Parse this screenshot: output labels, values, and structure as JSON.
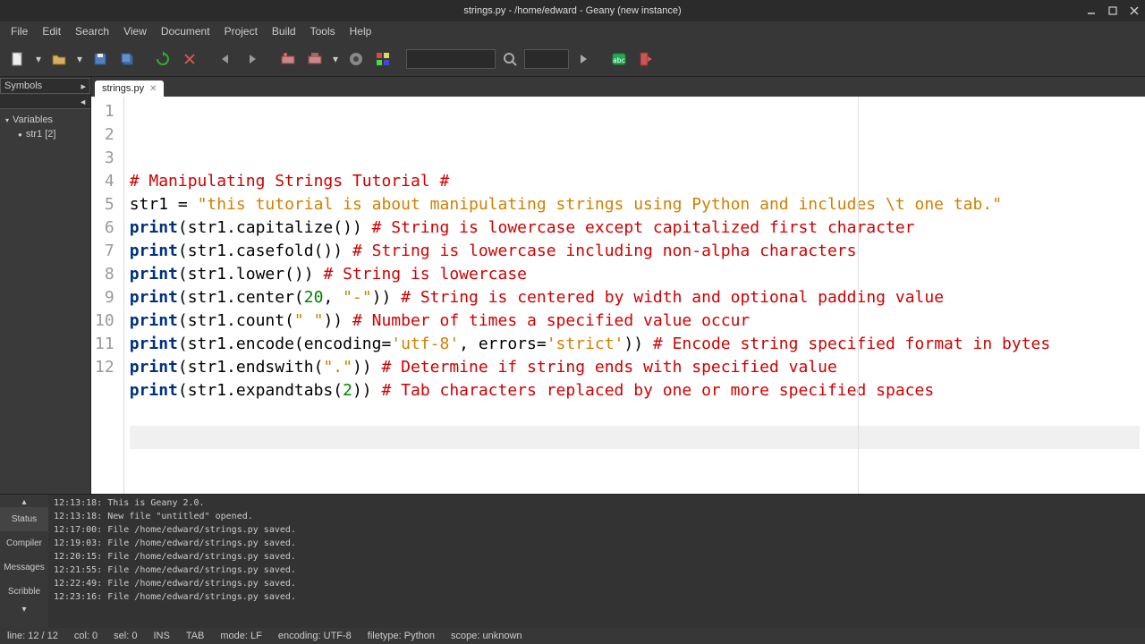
{
  "window": {
    "title": "strings.py - /home/edward - Geany (new instance)"
  },
  "menu": [
    "File",
    "Edit",
    "Search",
    "View",
    "Document",
    "Project",
    "Build",
    "Tools",
    "Help"
  ],
  "sidebar": {
    "selector": "Symbols",
    "items": [
      {
        "label": "Variables",
        "children": [
          {
            "label": "str1 [2]"
          }
        ]
      }
    ]
  },
  "tab": {
    "label": "strings.py"
  },
  "code_lines": [
    [
      {
        "t": "# Manipulating Strings Tutorial #",
        "c": "c-comment"
      }
    ],
    [
      {
        "t": "str1 ",
        "c": "c-ident"
      },
      {
        "t": "= ",
        "c": "c-ident"
      },
      {
        "t": "\"this tutorial is about manipulating strings using Python and includes \\t one tab.\"",
        "c": "c-string"
      }
    ],
    [
      {
        "t": "print",
        "c": "c-keyword"
      },
      {
        "t": "(str1.capitalize()) ",
        "c": "c-ident"
      },
      {
        "t": "# String is lowercase except capitalized first character",
        "c": "c-comment"
      }
    ],
    [
      {
        "t": "print",
        "c": "c-keyword"
      },
      {
        "t": "(str1.casefold()) ",
        "c": "c-ident"
      },
      {
        "t": "# String is lowercase including non-alpha characters",
        "c": "c-comment"
      }
    ],
    [
      {
        "t": "print",
        "c": "c-keyword"
      },
      {
        "t": "(str1.lower()) ",
        "c": "c-ident"
      },
      {
        "t": "# String is lowercase",
        "c": "c-comment"
      }
    ],
    [
      {
        "t": "print",
        "c": "c-keyword"
      },
      {
        "t": "(str1.center(",
        "c": "c-ident"
      },
      {
        "t": "20",
        "c": "c-number"
      },
      {
        "t": ", ",
        "c": "c-ident"
      },
      {
        "t": "\"-\"",
        "c": "c-string"
      },
      {
        "t": ")) ",
        "c": "c-ident"
      },
      {
        "t": "# String is centered by width and optional padding value",
        "c": "c-comment"
      }
    ],
    [
      {
        "t": "print",
        "c": "c-keyword"
      },
      {
        "t": "(str1.count(",
        "c": "c-ident"
      },
      {
        "t": "\" \"",
        "c": "c-string"
      },
      {
        "t": ")) ",
        "c": "c-ident"
      },
      {
        "t": "# Number of times a specified value occur",
        "c": "c-comment"
      }
    ],
    [
      {
        "t": "print",
        "c": "c-keyword"
      },
      {
        "t": "(str1.encode(encoding=",
        "c": "c-ident"
      },
      {
        "t": "'utf-8'",
        "c": "c-string"
      },
      {
        "t": ", errors=",
        "c": "c-ident"
      },
      {
        "t": "'strict'",
        "c": "c-string"
      },
      {
        "t": ")) ",
        "c": "c-ident"
      },
      {
        "t": "# Encode string specified format in bytes",
        "c": "c-comment"
      }
    ],
    [
      {
        "t": "print",
        "c": "c-keyword"
      },
      {
        "t": "(str1.endswith(",
        "c": "c-ident"
      },
      {
        "t": "\".\"",
        "c": "c-string"
      },
      {
        "t": ")) ",
        "c": "c-ident"
      },
      {
        "t": "# Determine if string ends with specified value",
        "c": "c-comment"
      }
    ],
    [
      {
        "t": "print",
        "c": "c-keyword"
      },
      {
        "t": "(str1.expandtabs(",
        "c": "c-ident"
      },
      {
        "t": "2",
        "c": "c-number"
      },
      {
        "t": ")) ",
        "c": "c-ident"
      },
      {
        "t": "# Tab characters replaced by one or more specified spaces",
        "c": "c-comment"
      }
    ],
    [
      {
        "t": "",
        "c": "c-ident"
      }
    ],
    [
      {
        "t": "",
        "c": "c-ident"
      }
    ]
  ],
  "messages_tabs": [
    "Status",
    "Compiler",
    "Messages",
    "Scribble"
  ],
  "messages": [
    "12:13:18: This is Geany 2.0.",
    "12:13:18: New file \"untitled\" opened.",
    "12:17:00: File /home/edward/strings.py saved.",
    "12:19:03: File /home/edward/strings.py saved.",
    "12:20:15: File /home/edward/strings.py saved.",
    "12:21:55: File /home/edward/strings.py saved.",
    "12:22:49: File /home/edward/strings.py saved.",
    "12:23:16: File /home/edward/strings.py saved."
  ],
  "status": {
    "line": "line: 12 / 12",
    "col": "col: 0",
    "sel": "sel: 0",
    "ins": "INS",
    "tab": "TAB",
    "mode": "mode: LF",
    "enc": "encoding: UTF-8",
    "filetype": "filetype: Python",
    "scope": "scope: unknown"
  }
}
